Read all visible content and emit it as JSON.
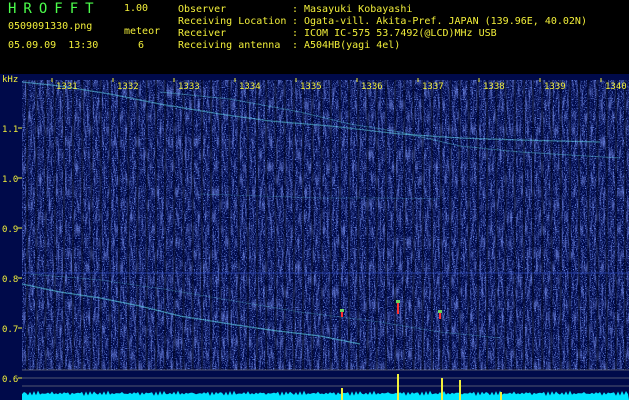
{
  "header": {
    "brand": "HROFFT",
    "version": "1.00",
    "file_name": "0509091330.png",
    "date_time": "05.09.09  13:30",
    "meteor_label": "meteor",
    "meteor_count": "6",
    "info": [
      {
        "label": "Observer",
        "value": "Masayuki Kobayashi"
      },
      {
        "label": "Receiving Location",
        "value": "Ogata-vill. Akita-Pref. JAPAN (139.96E, 40.02N)"
      },
      {
        "label": "Receiver",
        "value": "ICOM IC-575 53.7492(@LCD)MHz USB"
      },
      {
        "label": "Receiving antenna",
        "value": "A504HB(yagi 4el)"
      }
    ]
  },
  "spectrogram": {
    "y_unit": "kHz",
    "y_ticks": [
      "1.1",
      "1.0",
      "0.9",
      "0.8",
      "0.7",
      "0.6"
    ],
    "time_ticks": [
      "1331",
      "1332",
      "1333",
      "1334",
      "1335",
      "1336",
      "1337",
      "1338",
      "1339",
      "1340"
    ],
    "colors": {
      "background": "#000a4a",
      "noise": "#2a43c4",
      "trace": "#6cf0ff",
      "echo": "#ff3030",
      "level": "#00e5ff",
      "tick": "#f2ef3a",
      "grid": "#8a8a8a"
    }
  }
}
